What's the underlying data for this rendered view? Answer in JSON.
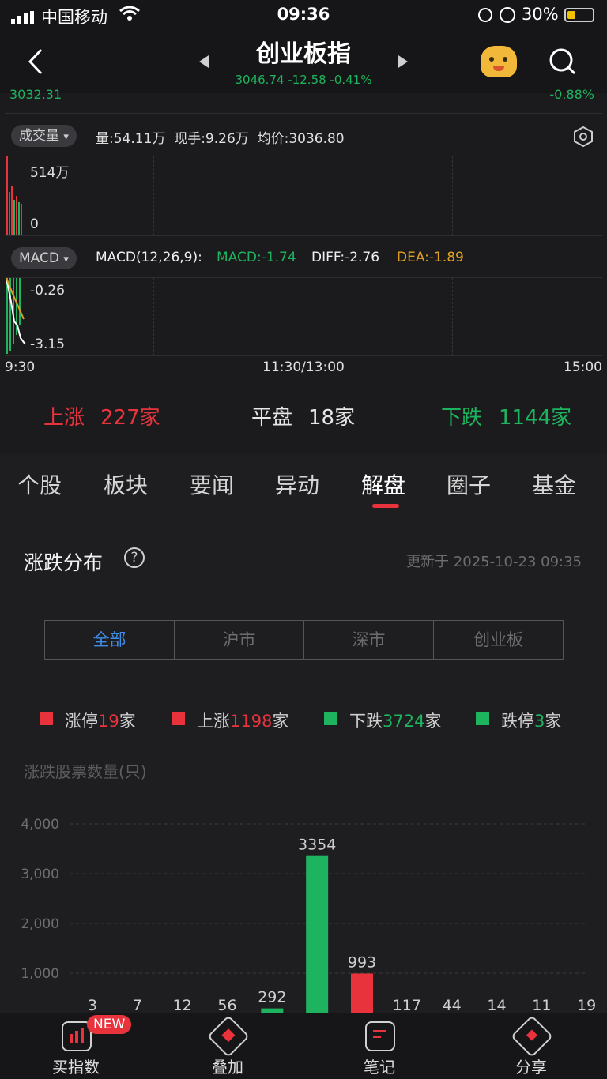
{
  "status": {
    "carrier": "中国移动",
    "time": "09:36",
    "battery": "30%"
  },
  "header": {
    "title": "创业板指",
    "subtitle": "3046.74 -12.58 -0.41%"
  },
  "chart_top": {
    "left_value": "3032.31",
    "right_value": "-0.88%"
  },
  "volume": {
    "selector": "成交量",
    "text": "量:54.11万  现手:9.26万  均价:3036.80",
    "max_label": "514万",
    "zero_label": "0"
  },
  "macd": {
    "selector": "MACD",
    "name": "MACD(12,26,9):",
    "macd": "MACD:-1.74",
    "diff": "DIFF:-2.76",
    "dea": "DEA:-1.89",
    "tick_top": "-0.26",
    "tick_bottom": "-3.15"
  },
  "time_axis": {
    "start": "9:30",
    "mid": "11:30/13:00",
    "end": "15:00"
  },
  "summary": {
    "up_label": "上涨",
    "up_value": "227家",
    "flat_label": "平盘",
    "flat_value": "18家",
    "down_label": "下跌",
    "down_value": "1144家"
  },
  "tabs": [
    "个股",
    "板块",
    "要闻",
    "异动",
    "解盘",
    "圈子",
    "基金"
  ],
  "active_tab": "解盘",
  "distribution": {
    "title": "涨跌分布",
    "updated": "更新于 2025-10-23 09:35",
    "segments": [
      "全部",
      "沪市",
      "深市",
      "创业板"
    ],
    "legend": [
      {
        "label": "涨停",
        "value": "19",
        "unit": "家",
        "color": "#e8333d"
      },
      {
        "label": "上涨",
        "value": "1198",
        "unit": "家",
        "color": "#e8333d"
      },
      {
        "label": "下跌",
        "value": "3724",
        "unit": "家",
        "color": "#1eb35e"
      },
      {
        "label": "跌停",
        "value": "3",
        "unit": "家",
        "color": "#1eb35e"
      }
    ],
    "axis_title": "涨跌股票数量(只)"
  },
  "chart_data": {
    "type": "bar",
    "ylabel": "涨跌股票数量(只)",
    "yticks": [
      "4,000",
      "3,000",
      "2,000",
      "1,000"
    ],
    "ylim": [
      0,
      4000
    ],
    "values": [
      3,
      7,
      12,
      56,
      292,
      3354,
      993,
      117,
      44,
      14,
      11,
      19
    ],
    "colors": [
      "#1eb35e",
      "#1eb35e",
      "#1eb35e",
      "#1eb35e",
      "#1eb35e",
      "#1eb35e",
      "#e8333d",
      "#e8333d",
      "#e8333d",
      "#e8333d",
      "#e8333d",
      "#e8333d"
    ]
  },
  "bottom": {
    "item1": "买指数",
    "badge": "NEW",
    "item2": "叠加",
    "item3": "笔记",
    "item4": "分享"
  },
  "colors": {
    "up": "#e8333d",
    "down": "#1eb35e",
    "dea": "#e0a020"
  }
}
